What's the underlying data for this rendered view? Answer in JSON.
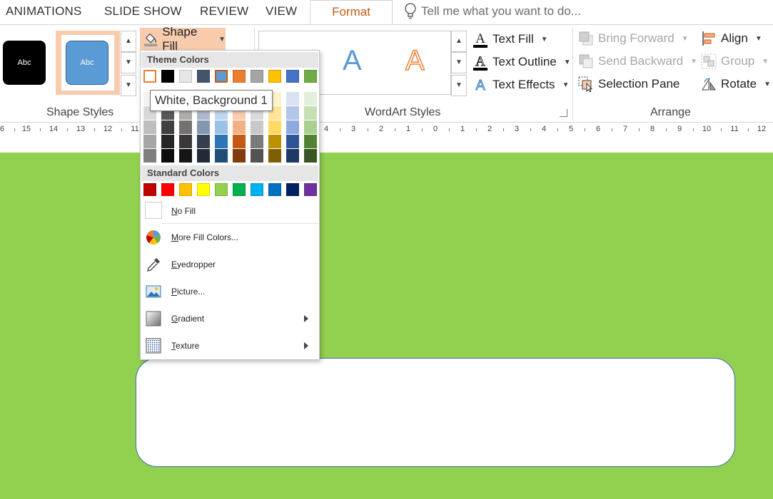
{
  "tabs": [
    "ANIMATIONS",
    "SLIDE SHOW",
    "REVIEW",
    "VIEW"
  ],
  "active_tab": "Format",
  "tell_me": "Tell me what you want to do...",
  "shape_styles": {
    "label": "Shape Styles",
    "preview1": "Abc",
    "preview2": "Abc"
  },
  "shape_fill": "Shape Fill",
  "wordart": {
    "label": "WordArt Styles",
    "sample1": "A",
    "sample2": "A",
    "text_fill": "Text Fill",
    "text_outline": "Text Outline",
    "text_effects": "Text Effects"
  },
  "arrange": {
    "label": "Arrange",
    "bring_forward": "Bring Forward",
    "send_backward": "Send Backward",
    "selection_pane": "Selection Pane",
    "align": "Align",
    "group": "Group",
    "rotate": "Rotate"
  },
  "ruler_labels": [
    "6",
    "15",
    "14",
    "13",
    "12",
    "11",
    "4",
    "3",
    "2",
    "1",
    "0",
    "1",
    "2",
    "3",
    "4",
    "5",
    "6",
    "7",
    "8",
    "9",
    "10",
    "11",
    "12"
  ],
  "menu": {
    "theme_colors_header": "Theme Colors",
    "standard_colors_header": "Standard Colors",
    "theme_top_row": [
      "#ffffff",
      "#000000",
      "#e7e6e6",
      "#44546a",
      "#5b9bd5",
      "#ed7d31",
      "#a5a5a5",
      "#ffc000",
      "#4472c4",
      "#70ad47"
    ],
    "theme_shades": [
      [
        "#f2f2f2",
        "#7f7f7f",
        "#d0cece",
        "#d6dce4",
        "#ddebf7",
        "#fbe5d6",
        "#ededed",
        "#fff2cc",
        "#d9e2f3",
        "#e2efda"
      ],
      [
        "#d9d9d9",
        "#595959",
        "#aeabab",
        "#adb9ca",
        "#bdd7ee",
        "#f8cbad",
        "#dbdbdb",
        "#ffe699",
        "#b4c6e7",
        "#c6e0b4"
      ],
      [
        "#bfbfbf",
        "#404040",
        "#757171",
        "#8497b0",
        "#9bc2e6",
        "#f4b084",
        "#c9c9c9",
        "#ffd966",
        "#8ea9db",
        "#a9d08e"
      ],
      [
        "#a6a6a6",
        "#262626",
        "#3a3838",
        "#333f4f",
        "#2e75b6",
        "#c65911",
        "#7b7b7b",
        "#bf9000",
        "#2f5597",
        "#548235"
      ],
      [
        "#7f7f7f",
        "#0d0d0d",
        "#171616",
        "#222a35",
        "#1f4e79",
        "#833c0b",
        "#525252",
        "#7f6000",
        "#1f3864",
        "#375623"
      ]
    ],
    "standard_colors": [
      "#c00000",
      "#ff0000",
      "#ffc000",
      "#ffff00",
      "#92d050",
      "#00b050",
      "#00b0f0",
      "#0070c0",
      "#002060",
      "#7030a0"
    ],
    "no_fill": "No Fill",
    "more_fill_colors": "More Fill Colors...",
    "eyedropper": "Eyedropper",
    "picture": "Picture...",
    "gradient": "Gradient",
    "texture": "Texture"
  },
  "tooltip": "White, Background 1",
  "colors": {
    "slide_background": "#92d050",
    "format_tab": "#c55a11",
    "selected_style": "#f8cbad"
  }
}
